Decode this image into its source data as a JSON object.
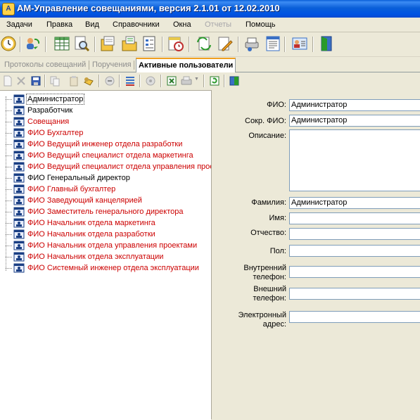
{
  "window": {
    "title": "АМ-Управление совещаниями, версия 2.1.01 от 12.02.2010",
    "icon": "app-logo-icon"
  },
  "menu": {
    "items": [
      {
        "label": "Задачи",
        "enabled": true
      },
      {
        "label": "Правка",
        "enabled": true
      },
      {
        "label": "Вид",
        "enabled": true
      },
      {
        "label": "Справочники",
        "enabled": true
      },
      {
        "label": "Окна",
        "enabled": true
      },
      {
        "label": "Отчеты",
        "enabled": false
      },
      {
        "label": "Помощь",
        "enabled": true
      }
    ]
  },
  "toolbar": {
    "icons": [
      "clock-icon",
      "users-refresh-icon",
      "table-icon",
      "search-document-icon",
      "documents-icon",
      "folder-documents-icon",
      "form-icon",
      "calendar-clock-icon",
      "sync-icon",
      "edit-document-icon",
      "printer-icon",
      "report-icon",
      "contact-card-icon",
      "exit-door-icon"
    ]
  },
  "tabs": [
    {
      "label": "Протоколы совещаний",
      "active": false
    },
    {
      "label": "Поручения",
      "active": false
    },
    {
      "label": "Активные пользователи",
      "active": true
    }
  ],
  "toolbar2": {
    "icons": [
      "new-icon",
      "delete-icon",
      "save-icon",
      "copy-icon",
      "paste-icon",
      "find-icon",
      "cancel-icon",
      "list-icon",
      "settings-icon",
      "excel-export-icon",
      "print-icon",
      "refresh-icon",
      "split-view-icon"
    ]
  },
  "tree": {
    "items": [
      {
        "label": "Администратор",
        "color": "#000000",
        "selected": true
      },
      {
        "label": "Разработчик",
        "color": "#000000",
        "selected": false
      },
      {
        "label": "Совещания",
        "color": "#cc0000",
        "selected": false
      },
      {
        "label": "ФИО Бухгалтер",
        "color": "#cc0000",
        "selected": false
      },
      {
        "label": "ФИО Ведущий инженер отдела разработки",
        "color": "#cc0000",
        "selected": false
      },
      {
        "label": "ФИО Ведущий специалист отдела маркетинга",
        "color": "#cc0000",
        "selected": false
      },
      {
        "label": "ФИО Ведущий специалист отдела управления проектами",
        "color": "#cc0000",
        "selected": false
      },
      {
        "label": "ФИО Генеральный директор",
        "color": "#000000",
        "selected": false
      },
      {
        "label": "ФИО Главный бухгалтер",
        "color": "#cc0000",
        "selected": false
      },
      {
        "label": "ФИО Заведующий канцелярией",
        "color": "#cc0000",
        "selected": false
      },
      {
        "label": "ФИО Заместитель генерального директора",
        "color": "#cc0000",
        "selected": false
      },
      {
        "label": "ФИО Начальник отдела маркетинга",
        "color": "#cc0000",
        "selected": false
      },
      {
        "label": "ФИО Начальник отдела разработки",
        "color": "#cc0000",
        "selected": false
      },
      {
        "label": "ФИО Начальник отдела управления проектами",
        "color": "#cc0000",
        "selected": false
      },
      {
        "label": "ФИО Начальник отдела эксплуатации",
        "color": "#cc0000",
        "selected": false
      },
      {
        "label": "ФИО Системный инженер отдела эксплуатации",
        "color": "#cc0000",
        "selected": false
      }
    ]
  },
  "form": {
    "fio": {
      "label": "ФИО:",
      "value": "Администратор"
    },
    "short_fio": {
      "label": "Сокр. ФИО:",
      "value": "Администратор"
    },
    "description": {
      "label": "Описание:",
      "value": ""
    },
    "surname": {
      "label": "Фамилия:",
      "value": "Администратор"
    },
    "name": {
      "label": "Имя:",
      "value": ""
    },
    "patronymic": {
      "label": "Отчество:",
      "value": ""
    },
    "gender": {
      "label": "Пол:",
      "value": ""
    },
    "internal_phone": {
      "label_line1": "Внутренний",
      "label_line2": "телефон:",
      "value": ""
    },
    "external_phone": {
      "label_line1": "Внешний",
      "label_line2": "телефон:",
      "value": ""
    },
    "email": {
      "label_line1": "Электронный",
      "label_line2": "адрес:",
      "value": ""
    }
  }
}
